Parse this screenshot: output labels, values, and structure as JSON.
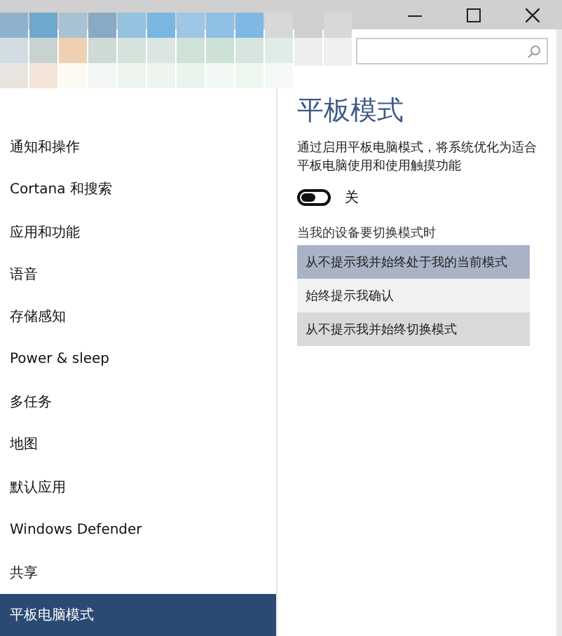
{
  "sidebar": {
    "items": [
      {
        "label": "通知和操作",
        "selected": false
      },
      {
        "label": "Cortana 和搜索",
        "selected": false
      },
      {
        "label": "应用和功能",
        "selected": false
      },
      {
        "label": "语音",
        "selected": false
      },
      {
        "label": "存储感知",
        "selected": false
      },
      {
        "label": "Power & sleep",
        "selected": false
      },
      {
        "label": "多任务",
        "selected": false
      },
      {
        "label": "地图",
        "selected": false
      },
      {
        "label": "默认应用",
        "selected": false
      },
      {
        "label": "Windows Defender",
        "selected": false
      },
      {
        "label": "共享",
        "selected": false
      },
      {
        "label": "平板电脑模式",
        "selected": true
      }
    ]
  },
  "content": {
    "heading": "平板模式",
    "description": "通过启用平板电脑模式，将系统优化为适合平板电脑使用和使用触摸功能",
    "toggle": {
      "on": false,
      "label": "关"
    },
    "dropdown_label": "当我的设备要切换模式时",
    "options": [
      {
        "label": "从不提示我并始终处于我的当前模式",
        "selected": true
      },
      {
        "label": "始终提示我确认",
        "selected": false
      },
      {
        "label": "从不提示我并始终切换模式",
        "selected": false
      }
    ]
  }
}
